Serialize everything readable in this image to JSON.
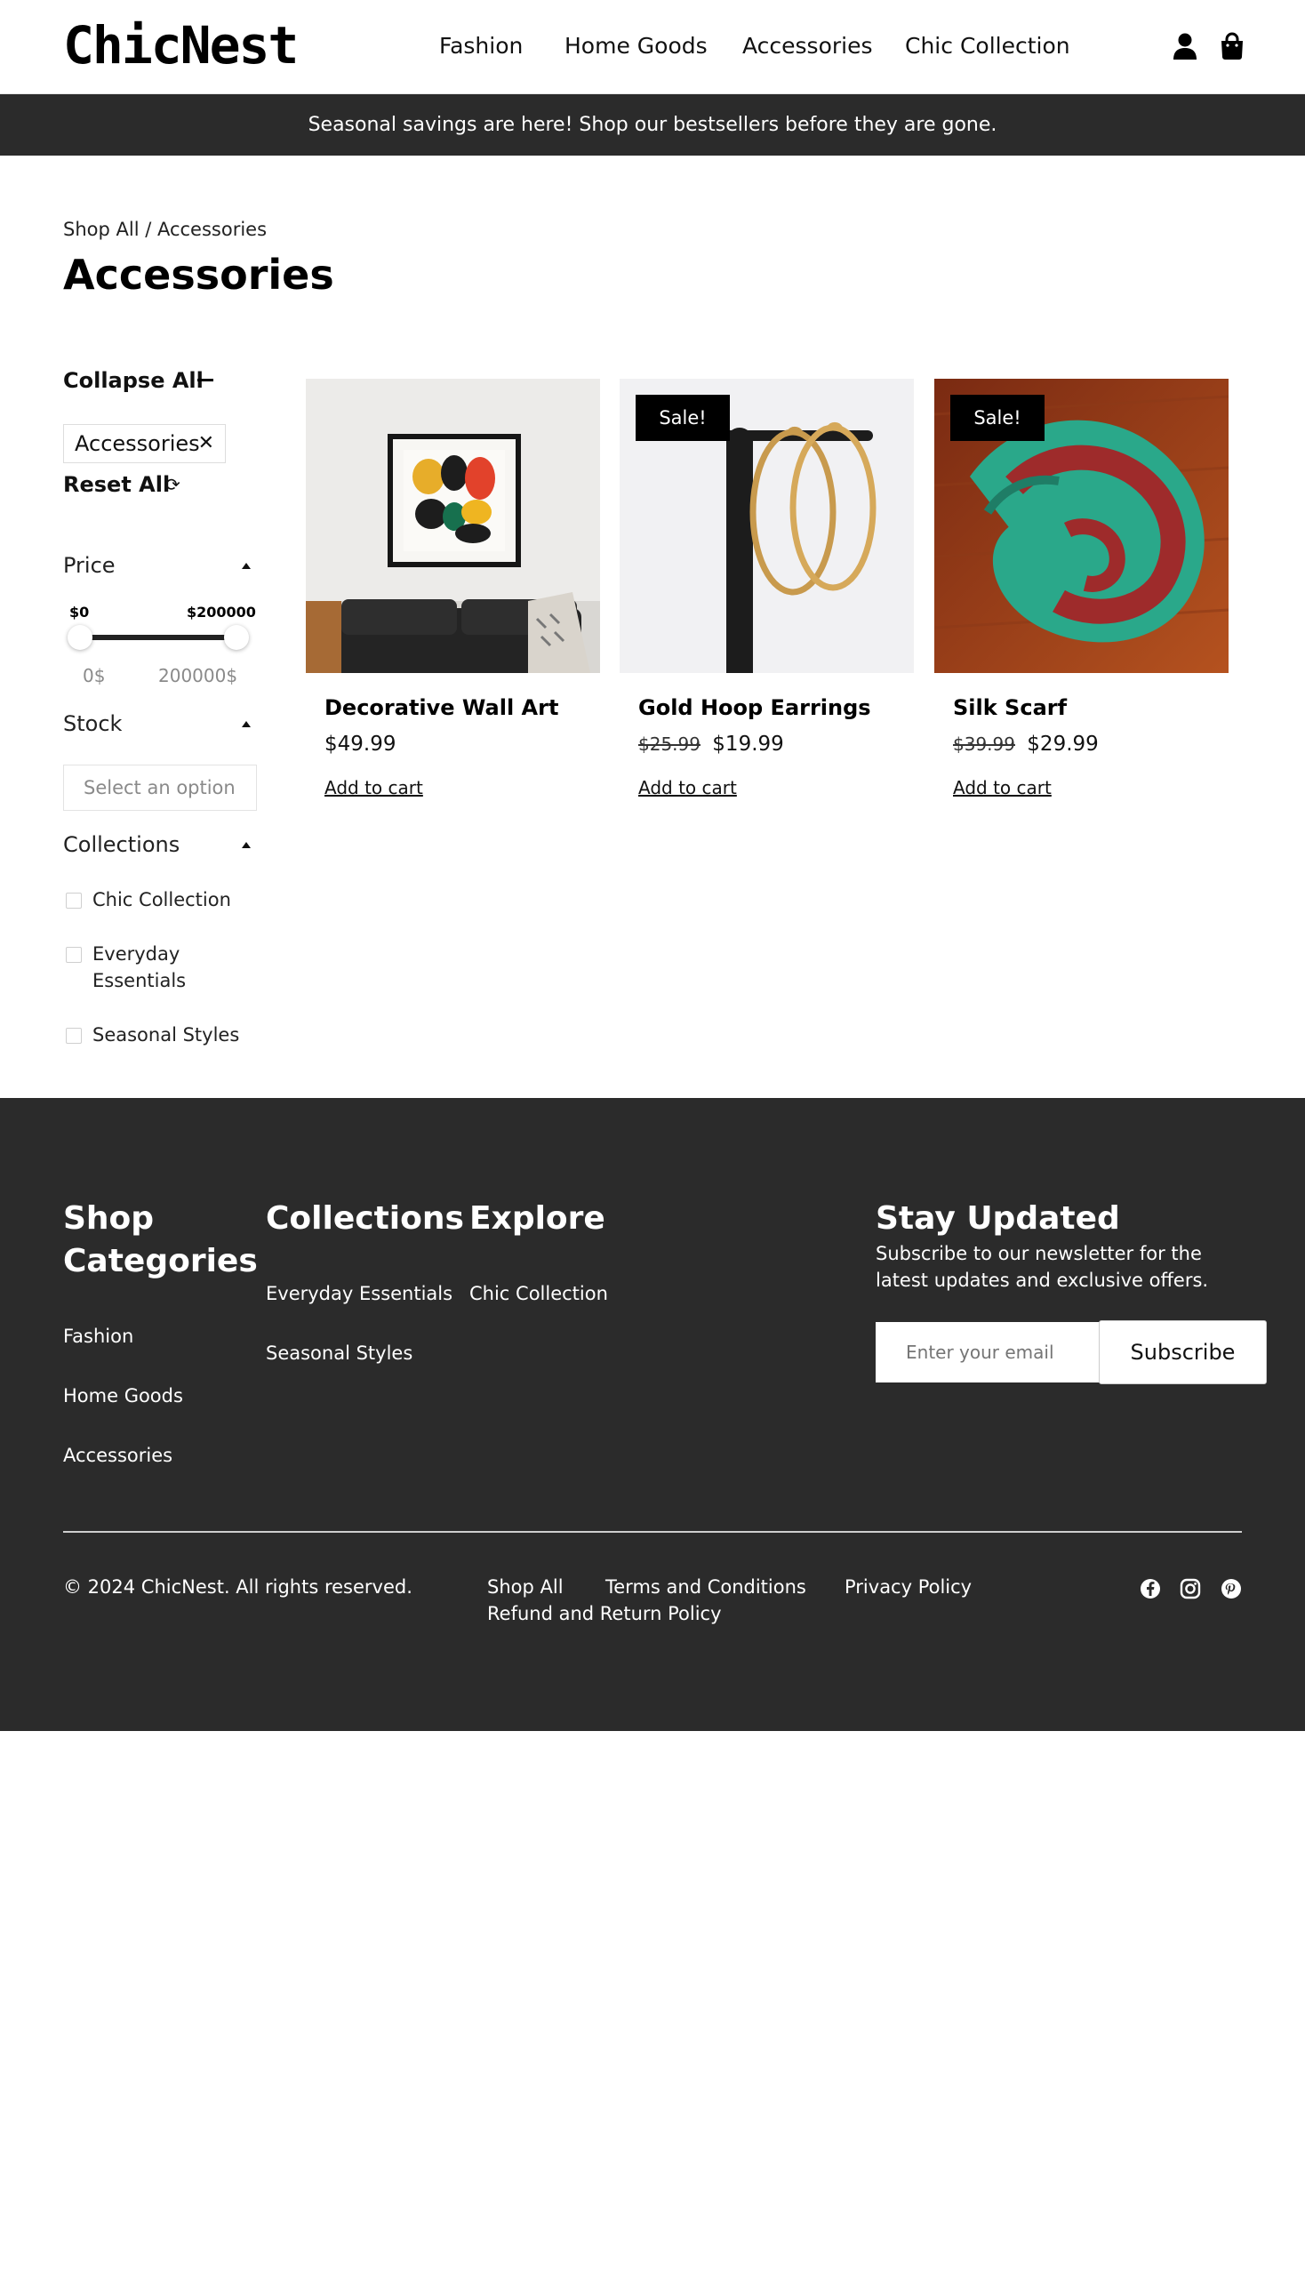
{
  "header": {
    "logo": "ChicNest",
    "nav": [
      "Fashion",
      "Home Goods",
      "Accessories",
      "Chic Collection"
    ],
    "icons": [
      "user-icon",
      "shopping-bag-icon"
    ]
  },
  "announcement": "Seasonal savings are here! Shop our bestsellers before they are gone.",
  "breadcrumb": "Shop All / Accessories",
  "page_title": "Accessories",
  "sidebar": {
    "collapse_all": "Collapse All",
    "active_filter": "Accessories",
    "reset_all": "Reset All",
    "price": {
      "title": "Price",
      "min_label": "$0",
      "max_label": "$200000",
      "min_value": "0$",
      "max_value": "200000$"
    },
    "stock": {
      "title": "Stock",
      "placeholder": "Select an option"
    },
    "collections": {
      "title": "Collections",
      "options": [
        "Chic Collection",
        "Everyday Essentials",
        "Seasonal Styles"
      ]
    }
  },
  "products": [
    {
      "name": "Decorative Wall Art",
      "old_price": "",
      "price": "$49.99",
      "sale": "",
      "cta": "Add to cart"
    },
    {
      "name": "Gold Hoop Earrings",
      "old_price": "$25.99",
      "price": "$19.99",
      "sale": "Sale!",
      "cta": "Add to cart"
    },
    {
      "name": "Silk Scarf",
      "old_price": "$39.99",
      "price": "$29.99",
      "sale": "Sale!",
      "cta": "Add to cart"
    }
  ],
  "footer": {
    "shop_categories": {
      "title": "Shop Categories",
      "links": [
        "Fashion",
        "Home Goods",
        "Accessories"
      ]
    },
    "collections": {
      "title": "Collections",
      "links": [
        "Everyday Essentials",
        "Seasonal Styles"
      ]
    },
    "explore": {
      "title": "Explore",
      "links": [
        "Chic Collection"
      ]
    },
    "newsletter": {
      "title": "Stay Updated",
      "text": "Subscribe to our newsletter for the latest updates and exclusive offers.",
      "placeholder": "Enter your email",
      "button": "Subscribe"
    },
    "copyright": "© 2024 ChicNest. All rights reserved.",
    "legal_links": [
      "Shop All",
      "Terms and Conditions",
      "Privacy Policy",
      "Refund and Return Policy"
    ],
    "social": [
      "facebook-icon",
      "instagram-icon",
      "pinterest-icon"
    ]
  },
  "colors": {
    "dark_band": "#2b2b2b",
    "sale_badge": "#000000"
  }
}
